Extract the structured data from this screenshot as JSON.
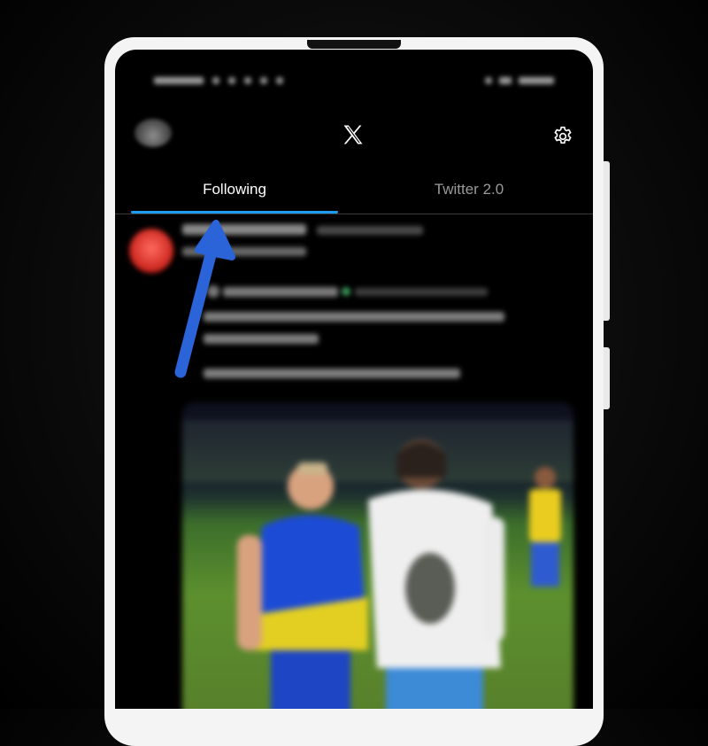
{
  "header": {
    "logo": "x-logo-icon",
    "settings_icon": "gear-icon"
  },
  "tabs": [
    {
      "label": "Following",
      "active": true
    },
    {
      "label": "Twitter 2.0",
      "active": false
    }
  ],
  "colors": {
    "accent": "#1d9bf0",
    "background": "#000000",
    "annotation_arrow": "#2b63d9"
  }
}
